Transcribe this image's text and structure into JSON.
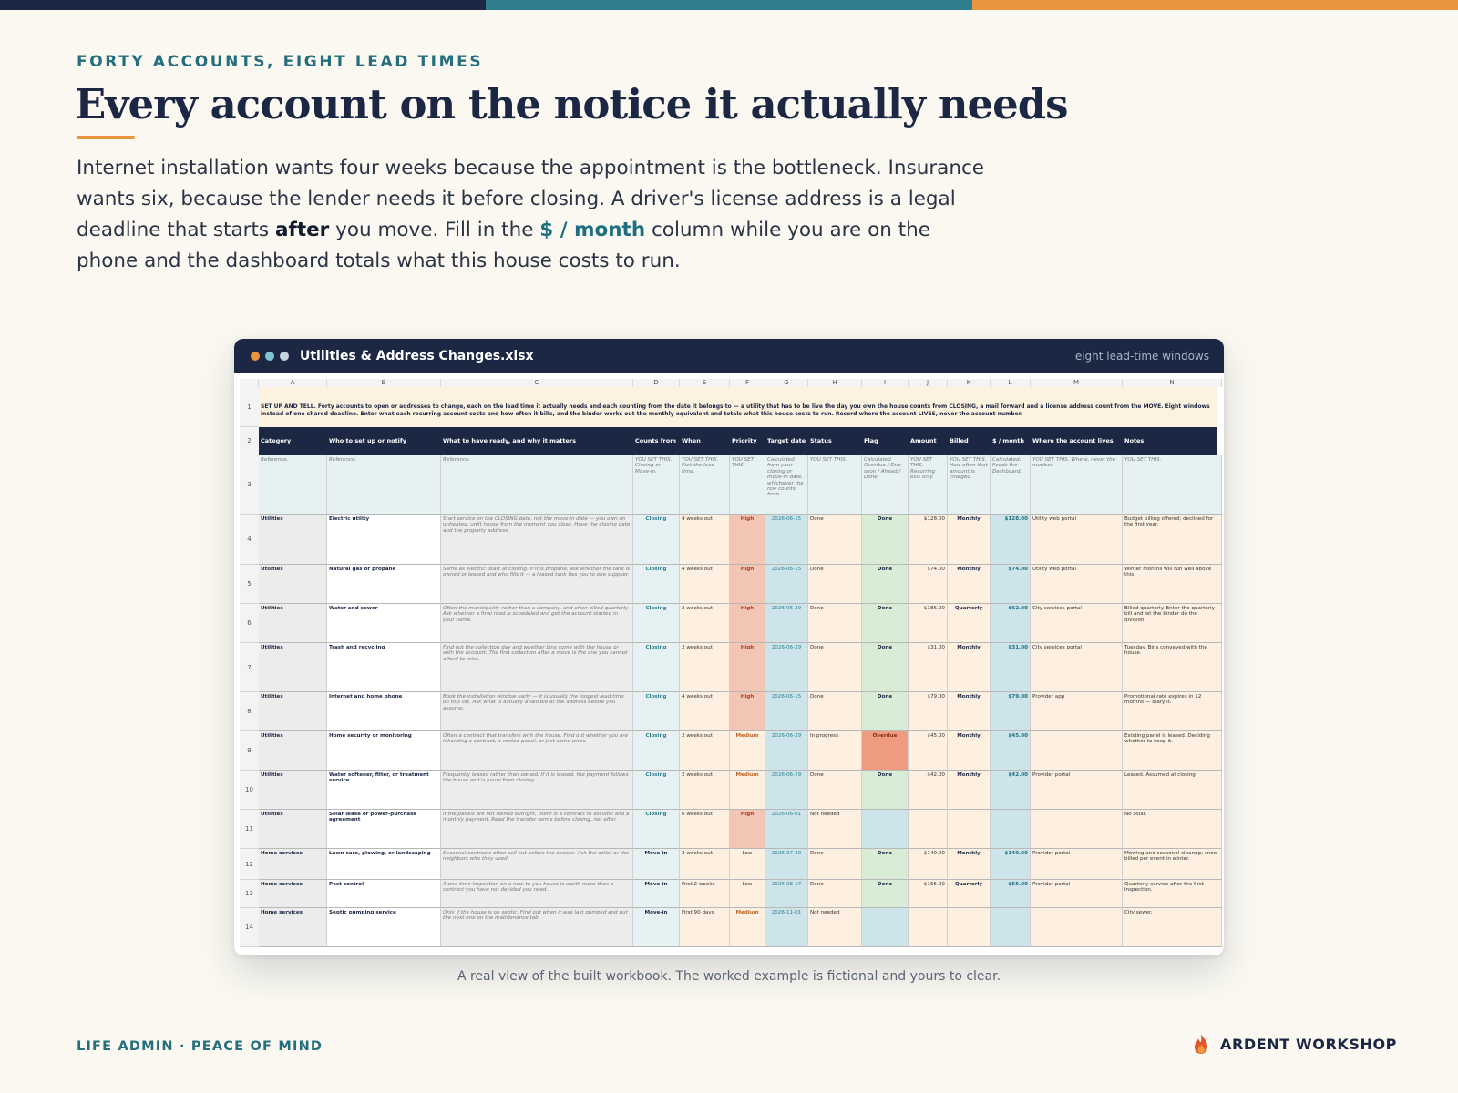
{
  "eyebrow": "FORTY ACCOUNTS, EIGHT LEAD TIMES",
  "headline": "Every account on the notice it actually needs",
  "intro": {
    "part1": "Internet installation wants four weeks because the appointment is the bottleneck. Insurance wants six, because the lender needs it before closing. A driver's license address is a legal deadline that starts ",
    "bold": "after",
    "part2": " you move. Fill in the ",
    "highlight": "$ / month",
    "part3": " column while you are on the phone and the dashboard totals what this house costs to run."
  },
  "window": {
    "title": "Utilities & Address Changes.xlsx",
    "subtitle": "eight lead-time windows",
    "dot_colors": [
      "#e8963e",
      "#7fc6d2",
      "#c9d2df"
    ]
  },
  "sheet": {
    "col_letters": [
      "A",
      "B",
      "C",
      "D",
      "E",
      "F",
      "G",
      "H",
      "I",
      "J",
      "K",
      "L",
      "M",
      "N"
    ],
    "banner": "SET UP AND TELL. Forty accounts to open or addresses to change, each on the lead time it actually needs and each counting from the date it belongs to — a utility that has to be live the day you own the house counts from CLOSING, a mail forward and a license address count from the MOVE. Eight windows instead of one shared deadline. Enter what each recurring account costs and how often it bills, and the binder works out the monthly equivalent and totals what this house costs to run. Record where the account LIVES, never the account number.",
    "headers": [
      "Category",
      "Who to set up or notify",
      "What to have ready, and why it matters",
      "Counts from",
      "When",
      "Priority",
      "Target date",
      "Status",
      "Flag",
      "Amount",
      "Billed",
      "$ / month",
      "Where the account lives",
      "Notes"
    ],
    "hints": [
      "Reference.",
      "Reference.",
      "Reference.",
      "YOU SET THIS. Closing or Move-in.",
      "YOU SET THIS. Pick the lead time.",
      "YOU SET THIS.",
      "Calculated from your closing or move-in date, whichever the row counts from.",
      "YOU SET THIS.",
      "Calculated. Overdue / Due soon / Ahead / Done.",
      "YOU SET THIS. Recurring bills only.",
      "YOU SET THIS. How often that amount is charged.",
      "Calculated. Feeds the Dashboard.",
      "YOU SET THIS. Where, never the number.",
      "YOU SET THIS."
    ],
    "rows": [
      {
        "num": "4",
        "cells": [
          "Utilities",
          "Electric utility",
          "Start service on the CLOSING date, not the move-in date — you own an unheated, unlit house from the moment you close. Have the closing date and the property address.",
          "Closing",
          "4 weeks out",
          "High",
          "2026-06-15",
          "Done",
          "Done",
          "$128.00",
          "Monthly",
          "$128.00",
          "Utility web portal",
          "Budget billing offered; declined for the first year."
        ]
      },
      {
        "num": "5",
        "cells": [
          "Utilities",
          "Natural gas or propane",
          "Same as electric: start at closing. If it is propane, ask whether the tank is owned or leased and who fills it — a leased tank ties you to one supplier.",
          "Closing",
          "4 weeks out",
          "High",
          "2026-06-15",
          "Done",
          "Done",
          "$74.00",
          "Monthly",
          "$74.00",
          "Utility web portal",
          "Winter months will run well above this."
        ]
      },
      {
        "num": "6",
        "cells": [
          "Utilities",
          "Water and sewer",
          "Often the municipality rather than a company, and often billed quarterly. Ask whether a final read is scheduled and get the account started in your name.",
          "Closing",
          "2 weeks out",
          "High",
          "2026-06-29",
          "Done",
          "Done",
          "$186.00",
          "Quarterly",
          "$62.00",
          "City services portal",
          "Billed quarterly. Enter the quarterly bill and let the binder do the division."
        ]
      },
      {
        "num": "7",
        "cells": [
          "Utilities",
          "Trash and recycling",
          "Find out the collection day and whether bins come with the house or with the account. The first collection after a move is the one you cannot afford to miss.",
          "Closing",
          "2 weeks out",
          "High",
          "2026-06-29",
          "Done",
          "Done",
          "$31.00",
          "Monthly",
          "$31.00",
          "City services portal",
          "Tuesday. Bins conveyed with the house."
        ]
      },
      {
        "num": "8",
        "cells": [
          "Utilities",
          "Internet and home phone",
          "Book the installation window early — it is usually the longest lead time on this list. Ask what is actually available at the address before you assume.",
          "Closing",
          "4 weeks out",
          "High",
          "2026-06-15",
          "Done",
          "Done",
          "$79.00",
          "Monthly",
          "$79.00",
          "Provider app",
          "Promotional rate expires in 12 months — diary it."
        ]
      },
      {
        "num": "9",
        "cells": [
          "Utilities",
          "Home security or monitoring",
          "Often a contract that transfers with the house. Find out whether you are inheriting a contract, a rented panel, or just some wires.",
          "Closing",
          "2 weeks out",
          "Medium",
          "2026-06-29",
          "In progress",
          "Overdue",
          "$45.00",
          "Monthly",
          "$45.00",
          "",
          "Existing panel is leased. Deciding whether to keep it."
        ]
      },
      {
        "num": "10",
        "cells": [
          "Utilities",
          "Water softener, filter, or treatment service",
          "Frequently leased rather than owned. If it is leased, the payment follows the house and is yours from closing.",
          "Closing",
          "2 weeks out",
          "Medium",
          "2026-06-29",
          "Done",
          "Done",
          "$42.00",
          "Monthly",
          "$42.00",
          "Provider portal",
          "Leased. Assumed at closing."
        ]
      },
      {
        "num": "11",
        "cells": [
          "Utilities",
          "Solar lease or power-purchase agreement",
          "If the panels are not owned outright, there is a contract to assume and a monthly payment. Read the transfer terms before closing, not after.",
          "Closing",
          "6 weeks out",
          "High",
          "2026-06-01",
          "Not needed",
          "",
          "",
          "",
          "",
          "",
          "No solar."
        ]
      },
      {
        "num": "12",
        "cells": [
          "Home services",
          "Lawn care, plowing, or landscaping",
          "Seasonal contracts often sell out before the season. Ask the seller or the neighbors who they used.",
          "Move-in",
          "2 weeks out",
          "Low",
          "2026-07-20",
          "Done",
          "Done",
          "$140.00",
          "Monthly",
          "$140.00",
          "Provider portal",
          "Mowing and seasonal cleanup; snow billed per event in winter."
        ]
      },
      {
        "num": "13",
        "cells": [
          "Home services",
          "Pest control",
          "A one-time inspection on a new-to-you house is worth more than a contract you have not decided you need.",
          "Move-in",
          "First 2 weeks",
          "Low",
          "2026-08-17",
          "Done",
          "Done",
          "$165.00",
          "Quarterly",
          "$55.00",
          "Provider portal",
          "Quarterly service after the first inspection."
        ]
      },
      {
        "num": "14",
        "cells": [
          "Home services",
          "Septic pumping service",
          "Only if the house is on septic. Find out when it was last pumped and put the next one on the maintenance tab.",
          "Move-in",
          "First 90 days",
          "Medium",
          "2026-11-01",
          "Not needed",
          "",
          "",
          "",
          "",
          "",
          "City sewer."
        ]
      }
    ]
  },
  "caption": "A real view of the built workbook. The worked example is fictional and yours to clear.",
  "footer": {
    "left": "LIFE ADMIN · PEACE OF MIND",
    "brand": "ARDENT WORKSHOP"
  }
}
